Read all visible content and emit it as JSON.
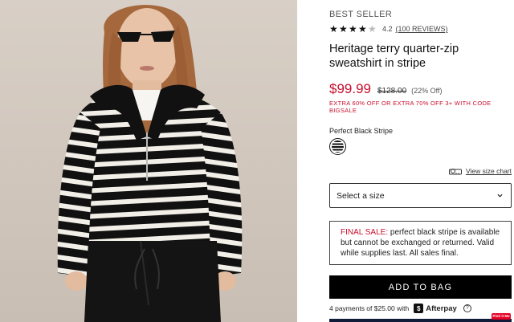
{
  "product": {
    "badge": "BEST SELLER",
    "rating_value": "4.2",
    "rating_stars": 4.2,
    "reviews_label": "(100 REVIEWS)",
    "title": "Heritage terry quarter-zip sweatshirt in stripe",
    "price": "$99.99",
    "original_price": "$128.00",
    "discount": "(22% Off)",
    "promo": "EXTRA 60% OFF OR EXTRA 70% OFF 3+ WITH CODE BIGSALE",
    "color_label": "Perfect Black Stripe",
    "size_chart_label": "View size chart",
    "size_select_label": "Select a size",
    "final_sale_prefix": "FINAL SALE:",
    "final_sale_text": " perfect black stripe is available but cannot be exchanged or returned. Valid while supplies last. All sales final.",
    "add_to_bag": "ADD TO BAG",
    "afterpay_text": "4 payments of $25.00 with",
    "afterpay_brand": "Afterpay",
    "afterpay_info": "?",
    "pinit_label": "Pinit it Me"
  },
  "colors": {
    "sale_red": "#c8102e",
    "button_black": "#000000"
  },
  "icons": {
    "star": "star-icon",
    "ruler": "ruler-icon",
    "chevron": "chevron-down-icon",
    "afterpay": "afterpay-logo-icon",
    "info": "info-circle-icon"
  }
}
